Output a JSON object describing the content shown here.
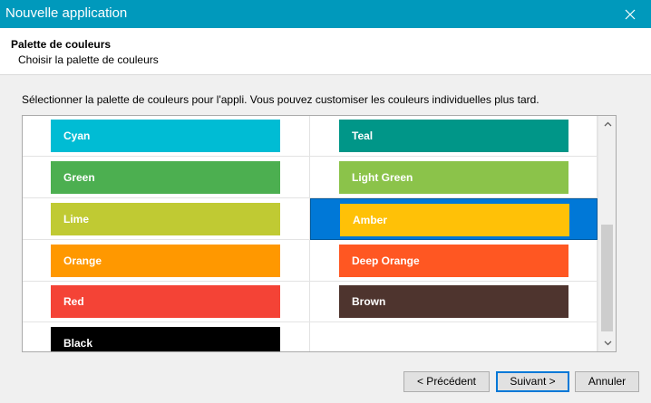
{
  "window": {
    "title": "Nouvelle application",
    "close_icon": "close-icon"
  },
  "header": {
    "title": "Palette de couleurs",
    "subtitle": "Choisir la palette de couleurs"
  },
  "instructions": "Sélectionner la palette de couleurs pour l'appli. Vous pouvez customiser les couleurs individuelles plus tard.",
  "palettes": [
    {
      "name": "Cyan",
      "color": "#00bcd4",
      "selected": false
    },
    {
      "name": "Teal",
      "color": "#009688",
      "selected": false
    },
    {
      "name": "Green",
      "color": "#4caf50",
      "selected": false
    },
    {
      "name": "Light Green",
      "color": "#8bc34a",
      "selected": false
    },
    {
      "name": "Lime",
      "color": "#c0ca33",
      "selected": false
    },
    {
      "name": "Amber",
      "color": "#ffc107",
      "selected": true
    },
    {
      "name": "Orange",
      "color": "#ff9800",
      "selected": false
    },
    {
      "name": "Deep Orange",
      "color": "#ff5722",
      "selected": false
    },
    {
      "name": "Red",
      "color": "#f44336",
      "selected": false
    },
    {
      "name": "Brown",
      "color": "#4e342e",
      "selected": false
    },
    {
      "name": "Black",
      "color": "#000000",
      "selected": false
    }
  ],
  "buttons": {
    "previous": "< Précédent",
    "next": "Suivant >",
    "cancel": "Annuler"
  },
  "colors": {
    "titlebar": "#0099bc",
    "selection": "#0078d7"
  }
}
